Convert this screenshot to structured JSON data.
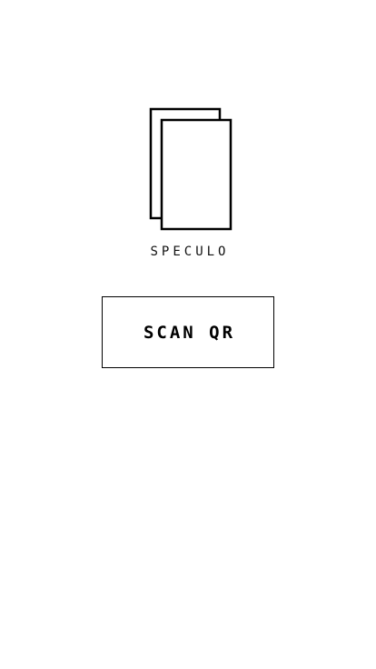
{
  "app": {
    "name": "SPECULO",
    "logo_icon": "stacked-pages-icon"
  },
  "actions": {
    "scan_label": "SCAN QR"
  },
  "colors": {
    "background": "#ffffff",
    "foreground": "#000000"
  }
}
